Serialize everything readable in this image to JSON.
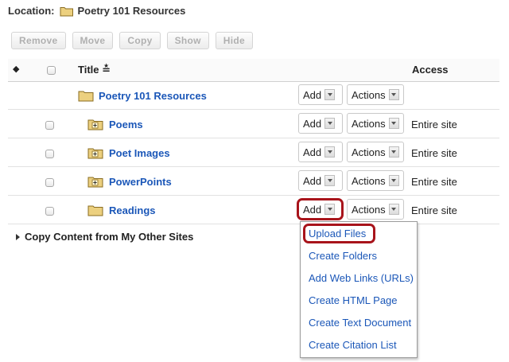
{
  "location": {
    "label": "Location:",
    "path": "Poetry 101 Resources"
  },
  "toolbar": {
    "remove": "Remove",
    "move": "Move",
    "copy": "Copy",
    "show": "Show",
    "hide": "Hide"
  },
  "table": {
    "sort_icon": "◆",
    "title_header": "Title ≛",
    "access_header": "Access",
    "root": {
      "title": "Poetry 101 Resources",
      "add": "Add",
      "actions": "Actions"
    },
    "rows": [
      {
        "title": "Poems",
        "add": "Add",
        "actions": "Actions",
        "access": "Entire site"
      },
      {
        "title": "Poet Images",
        "add": "Add",
        "actions": "Actions",
        "access": "Entire site"
      },
      {
        "title": "PowerPoints",
        "add": "Add",
        "actions": "Actions",
        "access": "Entire site"
      },
      {
        "title": "Readings",
        "add": "Add",
        "actions": "Actions",
        "access": "Entire site"
      }
    ]
  },
  "copy_content": "Copy Content from My Other Sites",
  "add_menu": {
    "items": [
      "Upload Files",
      "Create Folders",
      "Add Web Links (URLs)",
      "Create HTML Page",
      "Create Text Document",
      "Create Citation List"
    ]
  },
  "colors": {
    "link": "#1b57b8",
    "highlight": "#a8141b",
    "folder": "#e9c76b"
  }
}
